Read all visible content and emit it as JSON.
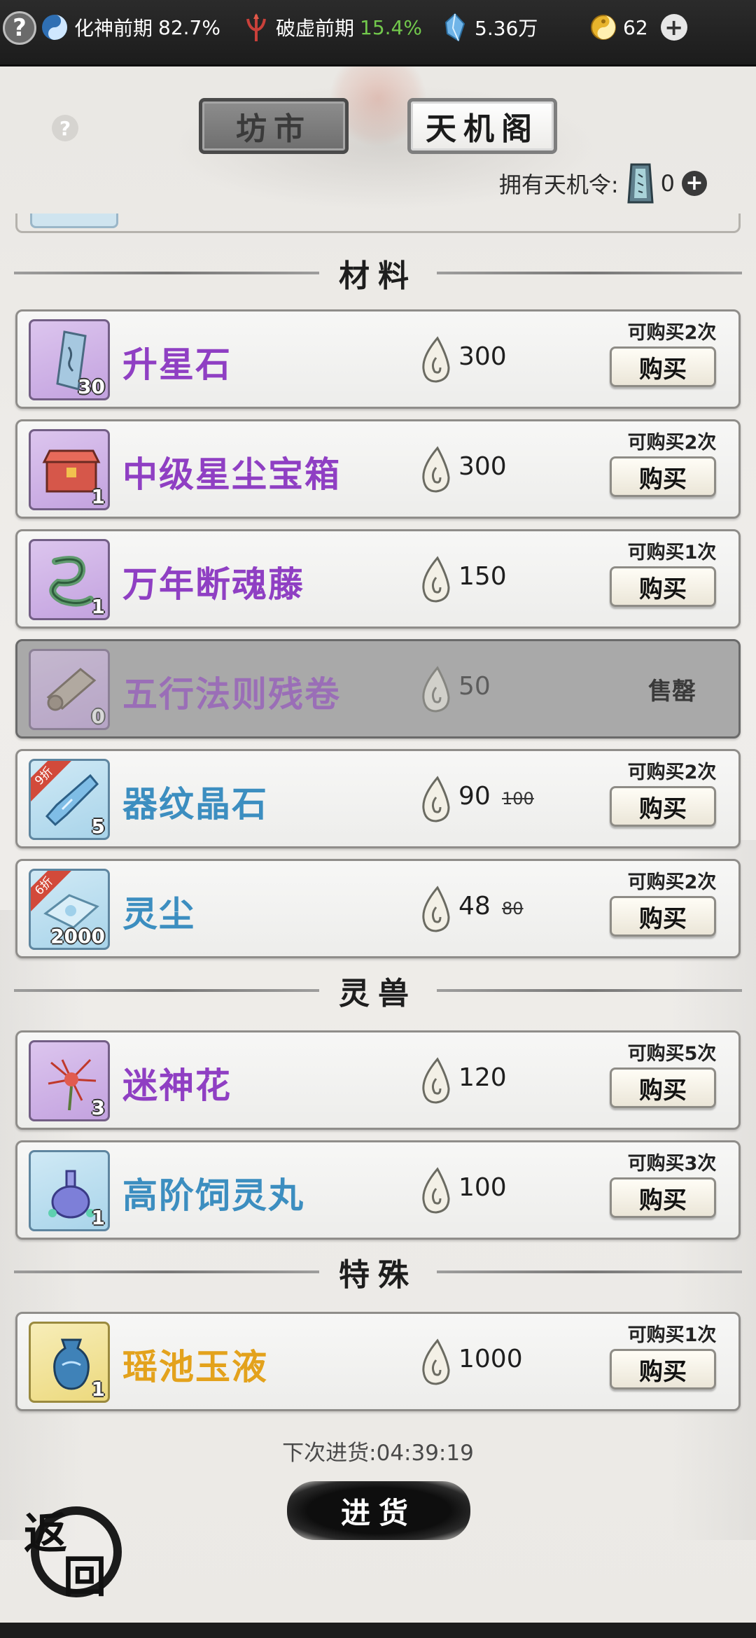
{
  "status_bar": {
    "help": "?",
    "cultivation": {
      "label": "化神前期",
      "value": "82.7%"
    },
    "breakthrough": {
      "label": "破虚前期",
      "value": "15.4%"
    },
    "spirit_stones": "5.36万",
    "jade": "62"
  },
  "header": {
    "help": "?",
    "tabs": [
      {
        "label": "坊市",
        "active": false
      },
      {
        "label": "天机阁",
        "active": true
      }
    ],
    "token_label": "拥有天机令:",
    "token_count": "0"
  },
  "sections": [
    {
      "title": "材料"
    },
    {
      "title": "灵兽"
    },
    {
      "title": "特殊"
    }
  ],
  "items": [
    {
      "name": "升星石",
      "qty": "30",
      "price": "300",
      "old_price": "",
      "discount": "",
      "limit": "可购买2次",
      "button": "购买",
      "rarity": "purple"
    },
    {
      "name": "中级星尘宝箱",
      "qty": "1",
      "price": "300",
      "old_price": "",
      "discount": "",
      "limit": "可购买2次",
      "button": "购买",
      "rarity": "purple"
    },
    {
      "name": "万年断魂藤",
      "qty": "1",
      "price": "150",
      "old_price": "",
      "discount": "",
      "limit": "可购买1次",
      "button": "购买",
      "rarity": "purple"
    },
    {
      "name": "五行法则残卷",
      "qty": "0",
      "price": "50",
      "old_price": "",
      "discount": "",
      "limit": "",
      "button": "售罄",
      "rarity": "purple",
      "sold_out": true
    },
    {
      "name": "器纹晶石",
      "qty": "5",
      "price": "90",
      "old_price": "100",
      "discount": "9折",
      "limit": "可购买2次",
      "button": "购买",
      "rarity": "blue"
    },
    {
      "name": "灵尘",
      "qty": "2000",
      "price": "48",
      "old_price": "80",
      "discount": "6折",
      "limit": "可购买2次",
      "button": "购买",
      "rarity": "blue"
    },
    {
      "name": "迷神花",
      "qty": "3",
      "price": "120",
      "old_price": "",
      "discount": "",
      "limit": "可购买5次",
      "button": "购买",
      "rarity": "purple"
    },
    {
      "name": "高阶饲灵丸",
      "qty": "1",
      "price": "100",
      "old_price": "",
      "discount": "",
      "limit": "可购买3次",
      "button": "购买",
      "rarity": "blue"
    },
    {
      "name": "瑶池玉液",
      "qty": "1",
      "price": "1000",
      "old_price": "",
      "discount": "",
      "limit": "可购买1次",
      "button": "购买",
      "rarity": "gold"
    }
  ],
  "footer": {
    "restock_timer": "下次进货:04:39:19",
    "restock_button": "进货",
    "back_button": [
      "返",
      "回"
    ]
  },
  "icons": {
    "currency": "spirit-drop-icon",
    "token": "tianji-token-icon"
  },
  "colors": {
    "purple": "#8f3fc3",
    "blue": "#3c8ec0",
    "gold": "#e3a21c",
    "green": "#72c84c"
  }
}
